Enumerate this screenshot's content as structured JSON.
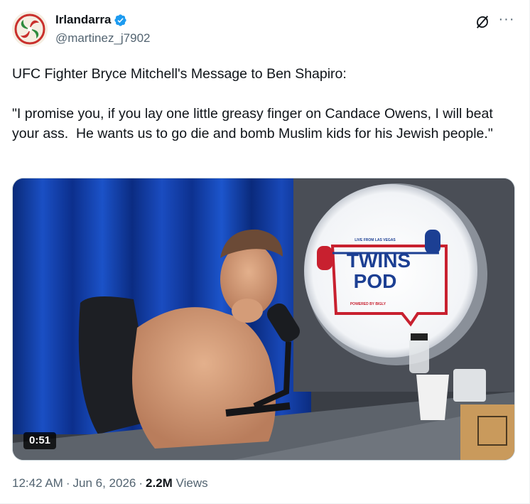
{
  "author": {
    "display_name": "Irlandarra",
    "handle": "@martinez_j7902",
    "verified": true
  },
  "post": {
    "text": "UFC Fighter Bryce Mitchell's Message to Ben Shapiro:\n\n\"I promise you, if you lay one little greasy finger on Candace Owens, I will beat your ass.  He wants us to go die and bomb Muslim kids for his Jewish people.\""
  },
  "video": {
    "duration": "0:51",
    "sign_top": "LIVE FROM LAS VEGAS",
    "sign_line1": "TWINS",
    "sign_line2": "POD",
    "sign_bottom": "POWERED BY BIGLY"
  },
  "meta": {
    "time": "12:42 AM",
    "date": "Jun 6, 2026",
    "views_count": "2.2M",
    "views_label": "Views",
    "dot": "·"
  },
  "icons": {
    "verified": "verified-badge-icon",
    "grok": "grok-icon",
    "more": "more-icon"
  },
  "colors": {
    "verified_blue": "#1d9bf0",
    "text_primary": "#0f1419",
    "text_secondary": "#536471"
  }
}
